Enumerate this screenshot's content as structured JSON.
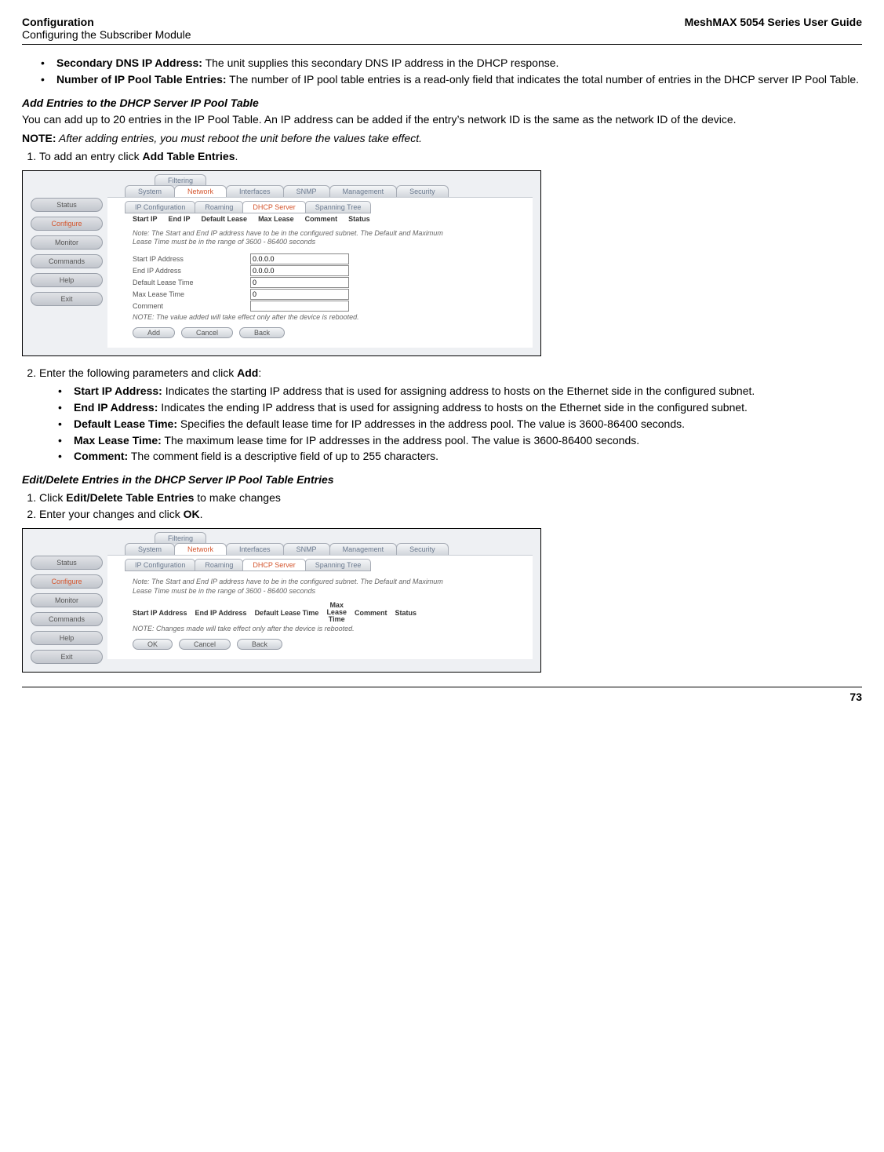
{
  "header": {
    "title": "Configuration",
    "subtitle": "Configuring the Subscriber Module",
    "guide": "MeshMAX 5054 Series User Guide"
  },
  "intro_bullets": [
    {
      "label": "Secondary DNS IP Address:",
      "text": " The unit supplies this secondary DNS IP address in the DHCP response."
    },
    {
      "label": "Number of IP Pool Table Entries:",
      "text": " The number of IP pool table entries is a read-only field that indicates the total number of entries in the DHCP server IP Pool Table."
    }
  ],
  "add_section": {
    "heading": "Add Entries to the DHCP Server IP Pool Table",
    "para": "You can add up to 20 entries in the IP Pool Table. An IP address can be added if the entry’s network ID is the same as the network ID of the device.",
    "note_label": "NOTE:",
    "note_text": " After adding entries, you must reboot the unit before the values take effect.",
    "step1_pre": "To add an entry click ",
    "step1_bold": "Add Table Entries",
    "step1_post": "."
  },
  "screenshot1": {
    "side": {
      "status": "Status",
      "configure": "Configure",
      "monitor": "Monitor",
      "commands": "Commands",
      "help": "Help",
      "exit": "Exit"
    },
    "toptabs": {
      "filtering": "Filtering"
    },
    "tabs": {
      "system": "System",
      "network": "Network",
      "interfaces": "Interfaces",
      "snmp": "SNMP",
      "management": "Management",
      "security": "Security"
    },
    "subtabs": {
      "ipconf": "IP Configuration",
      "roaming": "Roaming",
      "dhcp": "DHCP Server",
      "spanning": "Spanning Tree"
    },
    "cols": {
      "startip": "Start IP",
      "endip": "End IP",
      "deflease": "Default Lease",
      "maxlease": "Max Lease",
      "comment": "Comment",
      "status": "Status"
    },
    "note": "Note: The Start and End IP address have to be in the configured subnet. The Default and Maximum Lease Time must be in the range of 3600 - 86400 seconds",
    "fields": {
      "startip_lbl": "Start IP Address",
      "startip_val": "0.0.0.0",
      "endip_lbl": "End IP Address",
      "endip_val": "0.0.0.0",
      "deflease_lbl": "Default Lease Time",
      "deflease_val": "0",
      "maxlease_lbl": "Max Lease Time",
      "maxlease_val": "0",
      "comment_lbl": "Comment",
      "comment_val": ""
    },
    "note2": "NOTE: The value added will take effect only after the device is rebooted.",
    "btns": {
      "add": "Add",
      "cancel": "Cancel",
      "back": "Back"
    }
  },
  "after_shot1": {
    "step2_pre": "Enter the following parameters and click ",
    "step2_bold": "Add",
    "step2_post": ":",
    "bullets": [
      {
        "label": "Start IP Address:",
        "text": " Indicates the starting IP address that is used for assigning address to hosts on the Ethernet side in the configured subnet."
      },
      {
        "label": "End IP Address:",
        "text": " Indicates the ending IP address that is used for assigning address to hosts on the Ethernet side in the configured subnet."
      },
      {
        "label": "Default Lease Time:",
        "text": " Specifies the default lease time for IP addresses in the address pool. The value is 3600-86400 seconds."
      },
      {
        "label": "Max Lease Time:",
        "text": " The maximum lease time for IP addresses in the address pool. The value is 3600-86400 seconds."
      },
      {
        "label": "Comment:",
        "text": " The comment field is a descriptive field of up to 255 characters."
      }
    ]
  },
  "edit_section": {
    "heading": "Edit/Delete Entries in the DHCP Server IP Pool Table Entries",
    "step1_pre": "Click ",
    "step1_bold": "Edit/Delete Table Entries",
    "step1_post": " to make changes",
    "step2_pre": "Enter your changes and click ",
    "step2_bold": "OK",
    "step2_post": "."
  },
  "screenshot2": {
    "cols": {
      "startip": "Start IP Address",
      "endip": "End IP Address",
      "deflease": "Default Lease Time",
      "maxlease_l1": "Max",
      "maxlease_l2": "Lease",
      "maxlease_l3": "Time",
      "comment": "Comment",
      "status": "Status"
    },
    "note2": "NOTE: Changes made will take effect only after the device is rebooted.",
    "btns": {
      "ok": "OK",
      "cancel": "Cancel",
      "back": "Back"
    }
  },
  "page_number": "73"
}
